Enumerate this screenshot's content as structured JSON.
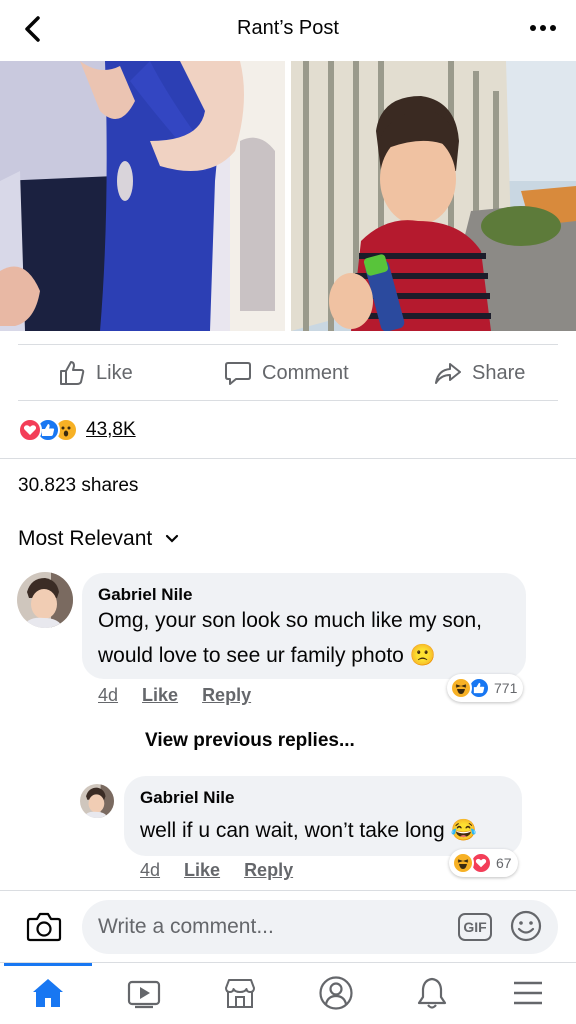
{
  "header": {
    "title": "Rant’s Post"
  },
  "actions": {
    "like": "Like",
    "comment": "Comment",
    "share": "Share"
  },
  "reactions": {
    "count": "43,8K",
    "types": [
      "love",
      "like",
      "wow"
    ]
  },
  "shares_text": "30.823 shares",
  "sort_label": "Most Relevant",
  "comments": [
    {
      "name": "Gabriel Nile",
      "text_line1": "Omg, your son look so much like my son,",
      "text_line2": "would love to see ur family photo 🙁",
      "time": "4d",
      "like": "Like",
      "reply": "Reply",
      "reaction_count": "771",
      "reaction_types": [
        "haha",
        "like"
      ]
    },
    {
      "name": "Gabriel Nile",
      "text": "well if u can wait, won’t take long 😂",
      "time": "4d",
      "like": "Like",
      "reply": "Reply",
      "reaction_count": "67",
      "reaction_types": [
        "haha",
        "love"
      ]
    }
  ],
  "view_previous": "View previous replies...",
  "composer": {
    "placeholder": "Write a comment...",
    "gif": "GIF"
  },
  "tabs": [
    "home-icon",
    "watch-icon",
    "marketplace-icon",
    "profile-icon",
    "notifications-icon",
    "menu-icon"
  ],
  "colors": {
    "accent": "#1877f2",
    "love": "#f33e58",
    "haha": "#f7b125",
    "text_secondary": "#65676b",
    "bubble": "#f0f2f5"
  }
}
